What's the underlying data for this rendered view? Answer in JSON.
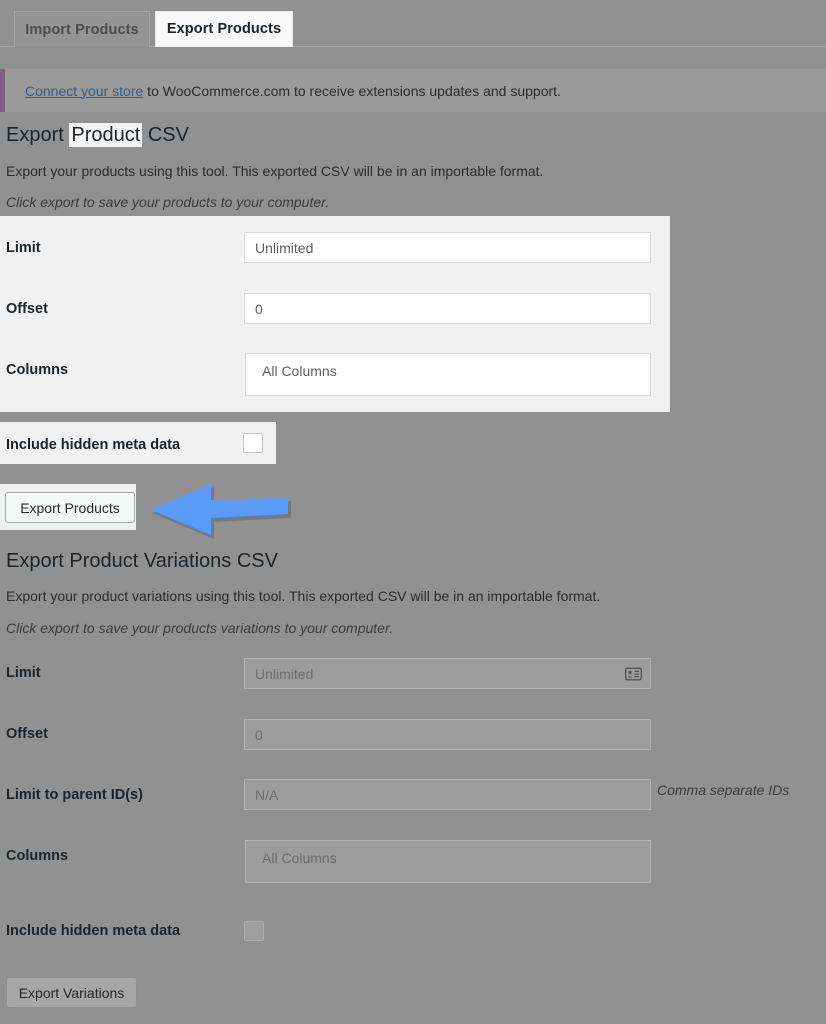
{
  "tabs": [
    {
      "label": "Import Products",
      "active": false
    },
    {
      "label": "Export Products",
      "active": true
    }
  ],
  "notice": {
    "link_text": "Connect your store",
    "rest_text": " to WooCommerce.com to receive extensions updates and support.",
    "accent_color": "#7e5f7f"
  },
  "product_section": {
    "heading_before": "Export ",
    "heading_highlight": "Product",
    "heading_after": " CSV",
    "description": "Export your products using this tool. This exported CSV will be in an importable format.",
    "hint": "Click export to save your products to your computer.",
    "fields": [
      {
        "label": "Limit",
        "value": "Unlimited"
      },
      {
        "label": "Offset",
        "value": "0"
      },
      {
        "label": "Columns",
        "value": "All Columns"
      }
    ],
    "checkbox": {
      "label": "Include hidden meta data",
      "checked": false
    },
    "submit_label": "Export Products"
  },
  "variations_section": {
    "heading": "Export Product Variations CSV",
    "description": "Export your product variations using this tool. This exported CSV will be in an importable format.",
    "hint": "Click export to save your products variations to your computer.",
    "fields": [
      {
        "label": "Limit",
        "value": "Unlimited",
        "icon": "autofill-contact-card-icon"
      },
      {
        "label": "Offset",
        "value": "0"
      },
      {
        "label": "Limit to parent ID(s)",
        "value": "N/A",
        "side_hint": "Comma separate IDs"
      },
      {
        "label": "Columns",
        "value": "All Columns"
      }
    ],
    "checkbox": {
      "label": "Include hidden meta data",
      "checked": false
    },
    "submit_label": "Export Variations"
  },
  "annotation": {
    "arrow_direction": "left",
    "arrow_color": "#5b9bf8"
  },
  "colors": {
    "dim_overlay": "#919191",
    "highlight_panel": "#f1f1f1",
    "link": "#2f5f8f"
  }
}
